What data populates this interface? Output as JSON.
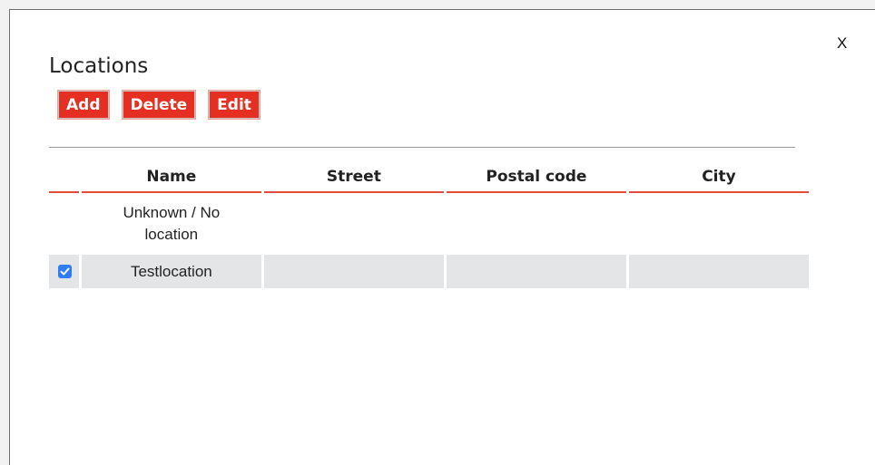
{
  "dialog": {
    "close_label": "X",
    "title": "Locations"
  },
  "toolbar": {
    "add_label": "Add",
    "delete_label": "Delete",
    "edit_label": "Edit"
  },
  "table": {
    "columns": [
      "Name",
      "Street",
      "Postal code",
      "City"
    ],
    "rows": [
      {
        "selected": false,
        "name": "Unknown / No location",
        "street": "",
        "postal_code": "",
        "city": ""
      },
      {
        "selected": true,
        "name": "Testlocation",
        "street": "",
        "postal_code": "",
        "city": ""
      }
    ]
  },
  "colors": {
    "accent": "#e52f22",
    "row_selected_bg": "#e3e5e7",
    "checkbox": "#2f7df6"
  }
}
